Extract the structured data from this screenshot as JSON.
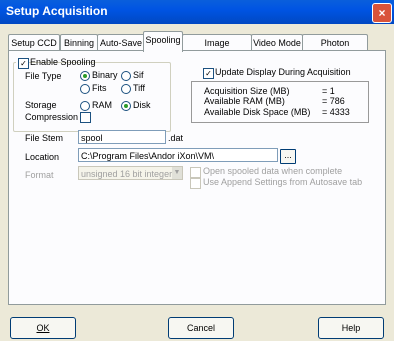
{
  "window": {
    "title": "Setup Acquisition"
  },
  "tabs": [
    "Setup CCD",
    "Binning",
    "Auto-Save",
    "Spooling",
    "Image Orientation",
    "Video Mode",
    "Photon Counting"
  ],
  "enable_spooling": {
    "label": "Enable Spooling"
  },
  "file_type": {
    "label": "File Type",
    "options": [
      "Binary",
      "Sif",
      "Fits",
      "Tiff"
    ]
  },
  "storage": {
    "label": "Storage",
    "options": [
      "RAM",
      "Disk"
    ]
  },
  "compression": {
    "label": "Compression"
  },
  "update_display": {
    "label": "Update Display During Acquisition"
  },
  "info": {
    "acq_size_label": "Acquisition Size (MB)",
    "acq_size_value": "= 1",
    "ram_label": "Available RAM (MB)",
    "ram_value": "= 786",
    "disk_label": "Available Disk Space (MB)",
    "disk_value": "= 4333"
  },
  "file_stem": {
    "label": "File Stem",
    "value": "spool",
    "ext": ".dat"
  },
  "location": {
    "label": "Location",
    "value": "C:\\Program Files\\Andor iXon\\VM\\",
    "browse": "..."
  },
  "format": {
    "label": "Format",
    "value": "unsigned 16 bit integer"
  },
  "open_spooled": {
    "label": "Open spooled data when complete"
  },
  "use_append": {
    "label": "Use Append Settings from Autosave tab"
  },
  "buttons": {
    "ok": "OK",
    "cancel": "Cancel",
    "help": "Help"
  }
}
